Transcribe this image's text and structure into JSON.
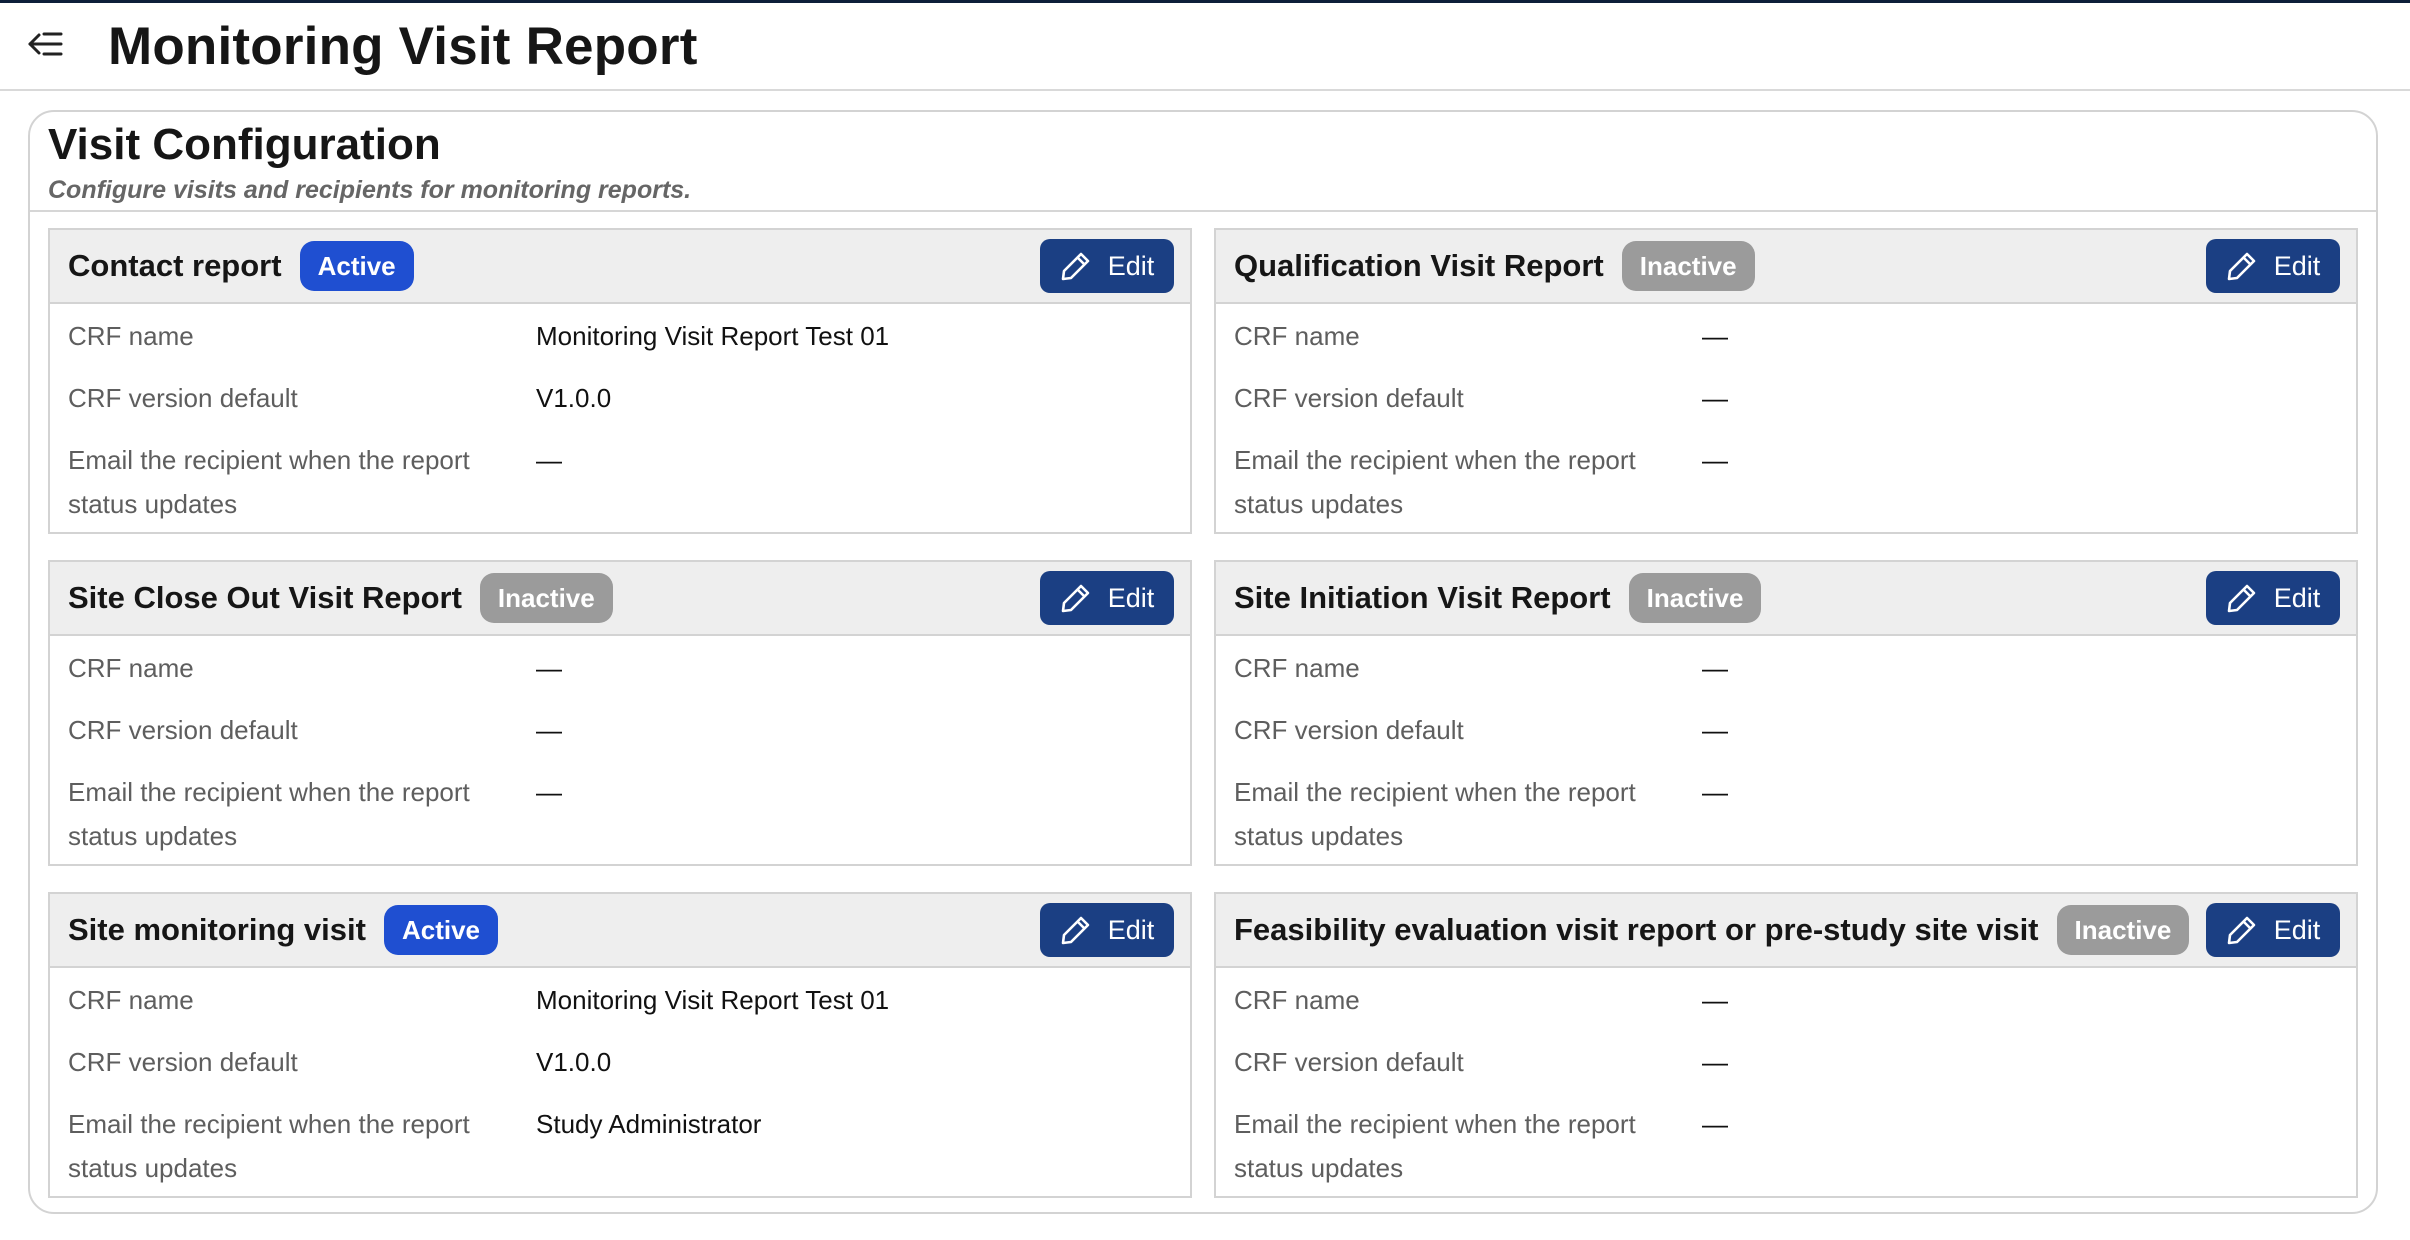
{
  "header": {
    "title": "Monitoring Visit Report",
    "back_icon": "collapse-menu-arrow-icon"
  },
  "panel": {
    "title": "Visit Configuration",
    "subtitle": "Configure visits and recipients for monitoring reports."
  },
  "labels": {
    "crf_name": "CRF name",
    "crf_version": "CRF version default",
    "email_recipient": "Email the recipient when the report status updates",
    "edit": "Edit"
  },
  "colors": {
    "active_badge": "#1f4fd1",
    "inactive_badge": "#9b9b9b",
    "edit_button": "#1b3f83"
  },
  "cards": [
    {
      "title": "Contact report",
      "status": "Active",
      "crf_name": "Monitoring Visit Report Test 01",
      "crf_version": "V1.0.0",
      "email": "—"
    },
    {
      "title": "Qualification Visit Report",
      "status": "Inactive",
      "crf_name": "—",
      "crf_version": "—",
      "email": "—"
    },
    {
      "title": "Site Close Out Visit Report",
      "status": "Inactive",
      "crf_name": "—",
      "crf_version": "—",
      "email": "—"
    },
    {
      "title": "Site Initiation Visit Report",
      "status": "Inactive",
      "crf_name": "—",
      "crf_version": "—",
      "email": "—"
    },
    {
      "title": "Site monitoring visit",
      "status": "Active",
      "crf_name": "Monitoring Visit Report Test 01",
      "crf_version": "V1.0.0",
      "email": "Study Administrator"
    },
    {
      "title": "Feasibility evaluation visit report or pre-study site visit",
      "status": "Inactive",
      "crf_name": "—",
      "crf_version": "—",
      "email": "—"
    }
  ]
}
